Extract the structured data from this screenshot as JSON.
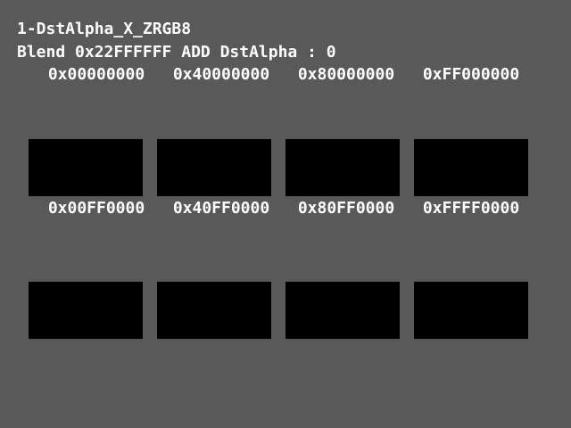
{
  "header": {
    "title": "1-DstAlpha_X_ZRGB8",
    "subtitle": "Blend 0x22FFFFFF ADD DstAlpha : 0"
  },
  "rows": [
    {
      "labels": [
        "0x00000000",
        "0x40000000",
        "0x80000000",
        "0xFF000000"
      ],
      "swatch_colors": [
        "#000000",
        "#000000",
        "#000000",
        "#000000"
      ]
    },
    {
      "labels": [
        "0x00FF0000",
        "0x40FF0000",
        "0x80FF0000",
        "0xFFFF0000"
      ],
      "swatch_colors": [
        "#000000",
        "#000000",
        "#000000",
        "#000000"
      ]
    }
  ],
  "colors": {
    "background": "#595959",
    "text": "#FFFFFF",
    "swatch": "#000000"
  }
}
